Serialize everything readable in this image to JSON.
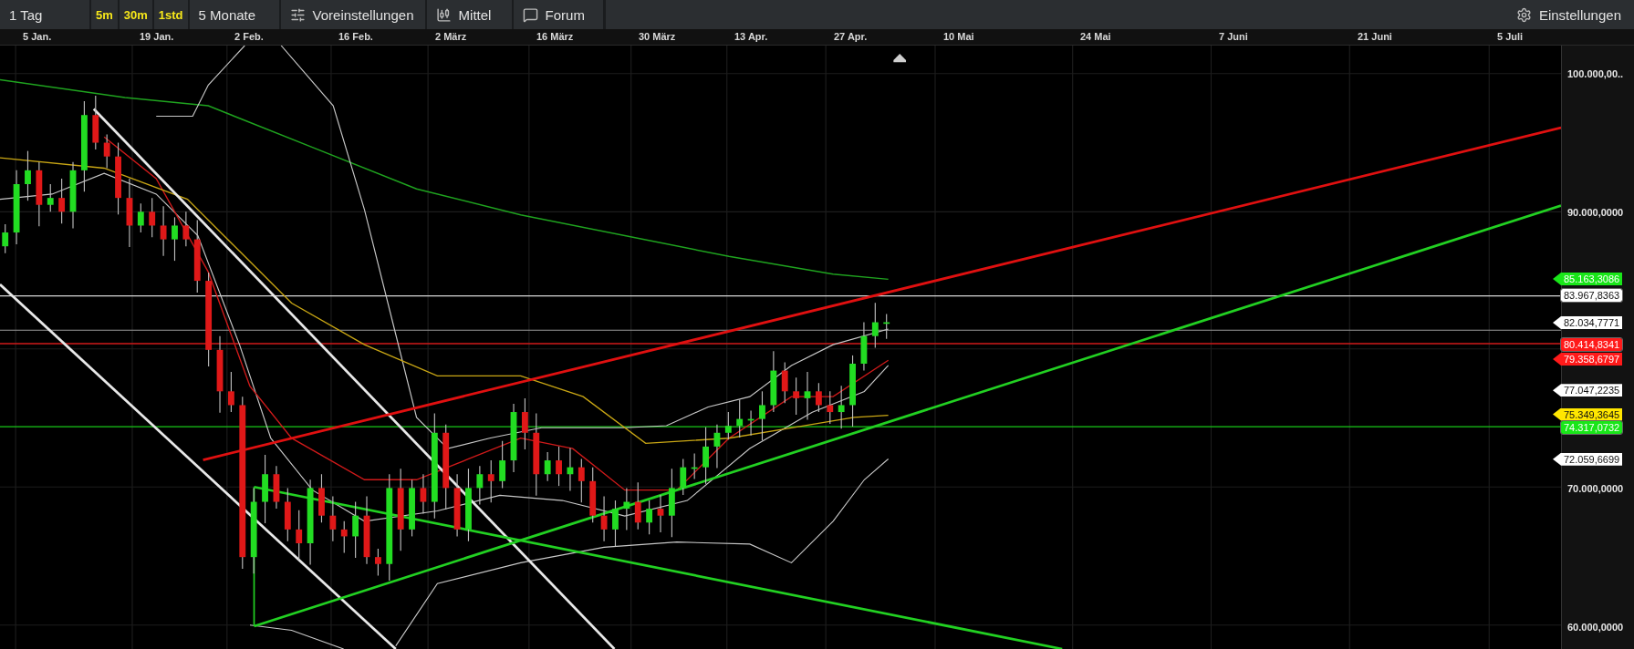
{
  "toolbar": {
    "items": [
      {
        "kind": "dropdown",
        "label": "1 Tag"
      },
      {
        "kind": "interval",
        "label": "5m"
      },
      {
        "kind": "interval",
        "label": "30m"
      },
      {
        "kind": "interval",
        "label": "1std"
      },
      {
        "kind": "dropdown",
        "label": "5 Monate"
      },
      {
        "kind": "presets",
        "label": "Voreinstellungen"
      },
      {
        "kind": "charttype",
        "label": "Mittel"
      },
      {
        "kind": "forum",
        "label": "Forum"
      }
    ],
    "settings": {
      "label": "Einstellungen"
    }
  },
  "x_axis": {
    "labels": [
      "5 Jan.",
      "19 Jan.",
      "2 Feb.",
      "16 Feb.",
      "2 März",
      "16 März",
      "30 März",
      "13 Apr.",
      "27 Apr.",
      "10 Mai",
      "24 Mai",
      "7 Juni",
      "21 Juni",
      "5 Juli"
    ]
  },
  "y_axis": {
    "ticks": [
      "100.000,00..",
      "90.000,0000",
      "70.000,0000",
      "60.000,0000"
    ]
  },
  "price_markers": [
    {
      "kind": "flag",
      "text": "85.163,3086",
      "color": "#19e619"
    },
    {
      "kind": "box",
      "text": "83.967,8363",
      "color": "#ffffff"
    },
    {
      "kind": "flag",
      "text": "82.034,7771",
      "color": "#ffffff"
    },
    {
      "kind": "box",
      "text": "80.414,8341",
      "color": "#ff1a1a"
    },
    {
      "kind": "flag",
      "text": "79.358,6797",
      "color": "#ff1a1a"
    },
    {
      "kind": "flag",
      "text": "77.047,2235",
      "color": "#ffffff"
    },
    {
      "kind": "flag",
      "text": "75.349,3645",
      "color": "#ffe600"
    },
    {
      "kind": "box",
      "text": "74.317,0732",
      "color": "#19e619"
    },
    {
      "kind": "flag",
      "text": "72.059,6699",
      "color": "#ffffff"
    }
  ]
}
